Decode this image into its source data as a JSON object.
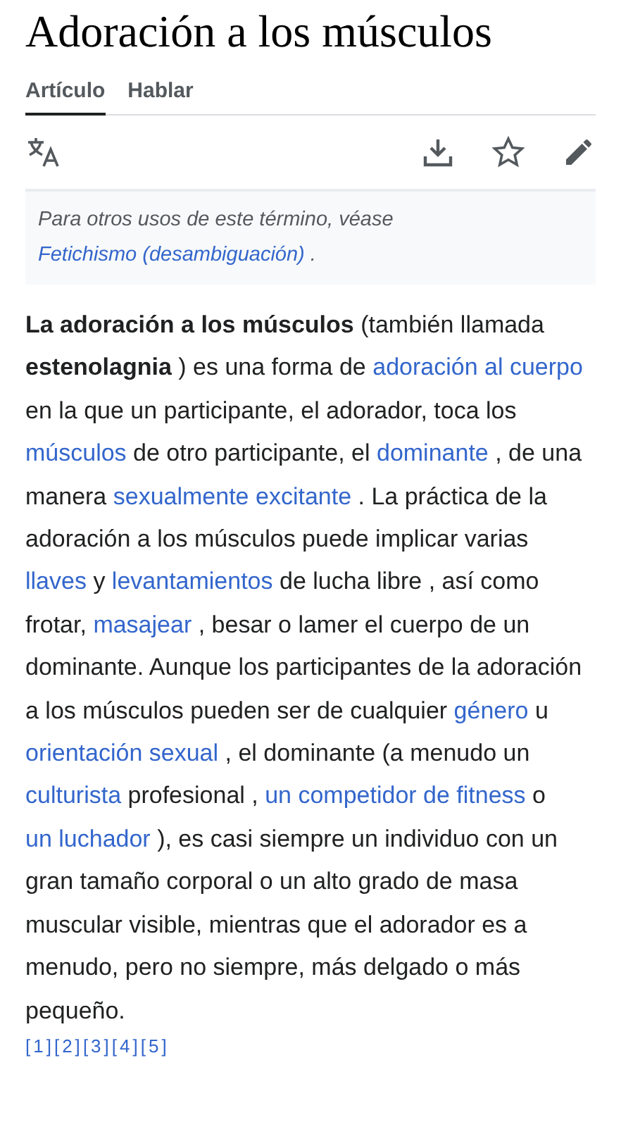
{
  "title": "Adoración a los músculos",
  "tabs": [
    {
      "label": "Artículo",
      "selected": true
    },
    {
      "label": "Hablar",
      "selected": false
    }
  ],
  "hatnote": [
    {
      "kind": "text",
      "text": "Para otros usos de este término, véase "
    },
    {
      "kind": "link",
      "text": "Fetichismo (desambiguación)"
    },
    {
      "kind": "text",
      "text": " ."
    }
  ],
  "paragraph": [
    {
      "kind": "bold",
      "text": "La adoración a los músculos"
    },
    {
      "kind": "text",
      "text": " (también llamada "
    },
    {
      "kind": "bold",
      "text": "estenolagnia"
    },
    {
      "kind": "text",
      "text": " ) es una forma de "
    },
    {
      "kind": "link",
      "text": "adoración al cuerpo"
    },
    {
      "kind": "text",
      "text": " en la que un participante, el adorador, toca los "
    },
    {
      "kind": "link",
      "text": "músculos"
    },
    {
      "kind": "text",
      "text": " de otro participante, el "
    },
    {
      "kind": "link",
      "text": "dominante"
    },
    {
      "kind": "text",
      "text": " , de una manera "
    },
    {
      "kind": "link",
      "text": "sexualmente excitante"
    },
    {
      "kind": "text",
      "text": " . La práctica de la adoración a los músculos puede implicar varias "
    },
    {
      "kind": "link",
      "text": "llaves"
    },
    {
      "kind": "text",
      "text": " y "
    },
    {
      "kind": "link",
      "text": "levantamientos"
    },
    {
      "kind": "text",
      "text": " de lucha libre , así como frotar, "
    },
    {
      "kind": "link",
      "text": "masajear"
    },
    {
      "kind": "text",
      "text": " , besar o lamer el cuerpo de un dominante. Aunque los participantes de la adoración a los músculos pueden ser de cualquier "
    },
    {
      "kind": "link",
      "text": "género"
    },
    {
      "kind": "text",
      "text": " u "
    },
    {
      "kind": "link",
      "text": "orientación sexual"
    },
    {
      "kind": "text",
      "text": " , el dominante (a menudo un "
    },
    {
      "kind": "link",
      "text": "culturista"
    },
    {
      "kind": "text",
      "text": " profesional , "
    },
    {
      "kind": "link",
      "text": "un competidor de fitness"
    },
    {
      "kind": "text",
      "text": " o "
    },
    {
      "kind": "link",
      "text": "un luchador"
    },
    {
      "kind": "text",
      "text": " ), es casi siempre un individuo con un gran tamaño corporal o un alto grado de masa muscular visible, mientras que el adorador es a menudo, pero no siempre, más delgado o más pequeño."
    }
  ],
  "references": [
    "[1]",
    "[2]",
    "[3]",
    "[4]",
    "[5]"
  ]
}
